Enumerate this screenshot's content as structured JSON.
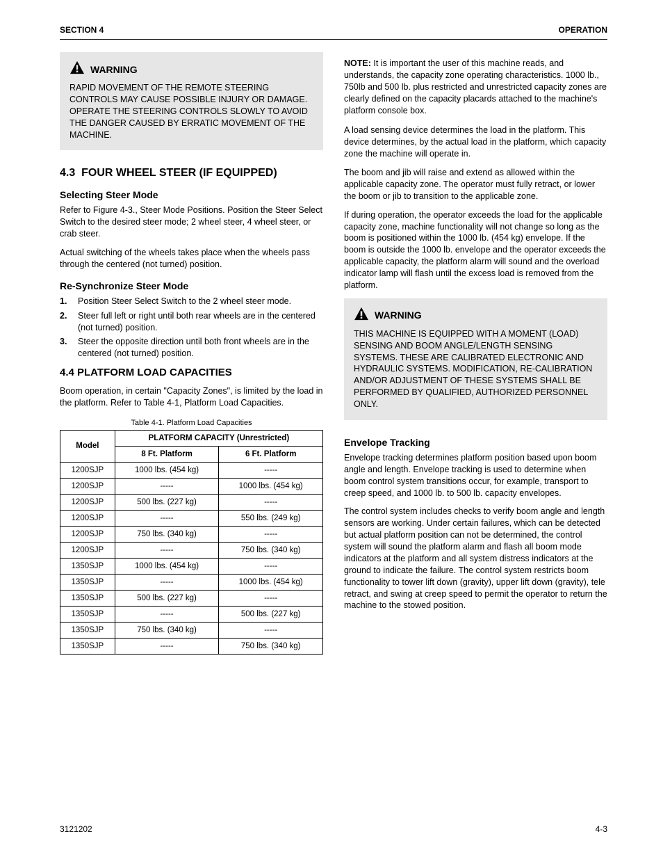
{
  "header": {
    "left": "SECTION 4",
    "right": "OPERATION"
  },
  "warn1": {
    "title": "WARNING",
    "body": "RAPID MOVEMENT OF THE REMOTE STEERING CONTROLS MAY CAUSE POSSIBLE INJURY OR DAMAGE. OPERATE THE STEERING CONTROLS SLOWLY TO AVOID THE DANGER CAUSED BY ERRATIC MOVEMENT OF THE MACHINE."
  },
  "section": {
    "num": "4.3",
    "title": "FOUR WHEEL STEER (IF EQUIPPED)"
  },
  "sub_selecting": "Selecting Steer Mode",
  "p_selecting_1": "Refer to Figure 4-3., Steer Mode Positions. Position the Steer Select Switch to the desired steer mode; 2 wheel steer, 4 wheel steer, or crab steer.",
  "p_selecting_2": "Actual switching of the wheels takes place when the wheels pass through the centered (not turned) position.",
  "sub_resync": "Re-Synchronize Steer Mode",
  "resync_items": [
    "Position Steer Select Switch to the 2 wheel steer mode.",
    "Steer full left or right until both rear wheels are in the centered (not turned) position.",
    "Steer the opposite direction until both front wheels are in the centered (not turned) position."
  ],
  "sub_capacities": "4.4  PLATFORM LOAD CAPACITIES",
  "p_capacities": "Boom operation, in certain \"Capacity Zones\", is limited by the load in the platform. Refer to Table 4-1, Platform Load Capacities.",
  "table_caption": "Table 4-1.   Platform Load Capacities",
  "chart_data": {
    "type": "table",
    "title": "Platform Load Capacities",
    "columns": [
      "Model",
      "8 Ft. Platform",
      "6 Ft. Platform"
    ],
    "header_group": "PLATFORM CAPACITY (Unrestricted)",
    "rows": [
      [
        "1200SJP",
        "1000 lbs. (454 kg)",
        "-----"
      ],
      [
        "1200SJP",
        "-----",
        "1000 lbs. (454 kg)"
      ],
      [
        "1200SJP",
        "500 lbs. (227 kg)",
        "-----"
      ],
      [
        "1200SJP",
        "-----",
        "550 lbs. (249 kg)"
      ],
      [
        "1200SJP",
        "750 lbs. (340 kg)",
        "-----"
      ],
      [
        "1200SJP",
        "-----",
        "750 lbs. (340 kg)"
      ],
      [
        "1350SJP",
        "1000 lbs. (454 kg)",
        "-----"
      ],
      [
        "1350SJP",
        "-----",
        "1000 lbs. (454 kg)"
      ],
      [
        "1350SJP",
        "500 lbs. (227 kg)",
        "-----"
      ],
      [
        "1350SJP",
        "-----",
        "500 lbs. (227 kg)"
      ],
      [
        "1350SJP",
        "750 lbs. (340 kg)",
        "-----"
      ],
      [
        "1350SJP",
        "-----",
        "750 lbs. (340 kg)"
      ]
    ]
  },
  "r_note": {
    "label": "NOTE:",
    "body": "It is important the user of this machine reads, and understands, the capacity zone operating characteristics. 1000 lb., 750lb and 500 lb. plus restricted and unrestricted capacity zones are clearly defined on the capacity placards attached to the machine's platform console box."
  },
  "r_p1": "A load sensing device determines the load in the platform. This device determines, by the actual load in the platform, which capacity zone the machine will operate in.",
  "r_p2": "The boom and jib will raise and extend as allowed within the applicable capacity zone. The operator must fully retract, or lower the boom or jib to transition to the applicable zone.",
  "r_p3": "If during operation, the operator exceeds the load for the applicable capacity zone, machine functionality will not change so long as the boom is positioned within the 1000 lb. (454 kg) envelope. If the boom is outside the 1000 lb. envelope and the operator exceeds the applicable capacity, the platform alarm will sound and the overload indicator lamp will flash until the excess load is removed from the platform.",
  "warn2": {
    "title": "WARNING",
    "body": "THIS MACHINE IS EQUIPPED WITH A MOMENT (LOAD) SENSING AND BOOM ANGLE/LENGTH SENSING SYSTEMS. THESE ARE CALIBRATED ELECTRONIC AND HYDRAULIC SYSTEMS. MODIFICATION, RE-CALIBRATION AND/OR ADJUSTMENT OF THESE SYSTEMS SHALL BE PERFORMED BY QUALIFIED, AUTHORIZED PERSONNEL ONLY."
  },
  "sub_envelope": "Envelope Tracking",
  "p_env1": "Envelope tracking determines platform position based upon boom angle and length. Envelope tracking is used to determine when boom control system transitions occur, for example, transport to creep speed, and 1000 lb. to 500 lb. capacity envelopes.",
  "p_env2": "The control system includes checks to verify boom angle and length sensors are working. Under certain failures, which can be detected but actual platform position can not be determined, the control system will sound the platform alarm and flash all boom mode indicators at the platform and all system distress indicators at the ground to indicate the failure. The control system restricts boom functionality to tower lift down (gravity), upper lift down (gravity), tele retract, and swing at creep speed to permit the operator to return the machine to the stowed position.",
  "footer": {
    "left": "3121202",
    "right": "4-3"
  }
}
